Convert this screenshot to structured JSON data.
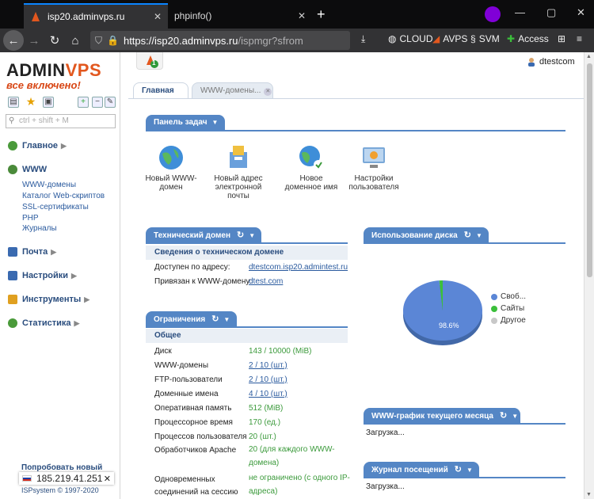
{
  "browser": {
    "tabs": [
      {
        "title": "isp20.adminvps.ru",
        "active": true
      },
      {
        "title": "phpinfo()",
        "active": false
      }
    ],
    "new_tab": "+",
    "url_host": "https://isp20.adminvps.ru",
    "url_rest": "/ispmgr?sfrom",
    "bookmarks": [
      "CLOUD",
      "AVPS",
      "SVM",
      "Access"
    ],
    "window_controls": [
      "—",
      "▢",
      "✕"
    ]
  },
  "logo": {
    "brand_a": "ADMIN",
    "brand_b": "VPS",
    "tagline": "все включено!"
  },
  "sidebar": {
    "search_placeholder": "ctrl + shift + M",
    "sections": [
      {
        "label": "Главное",
        "icon": "leaf-icon",
        "color": "#4a9a3a"
      },
      {
        "label": "WWW",
        "icon": "globe-icon",
        "color": "#4a8a3a"
      },
      {
        "label": "Почта",
        "icon": "mail-icon",
        "color": "#3a6ab0"
      },
      {
        "label": "Настройки",
        "icon": "settings-icon",
        "color": "#3a6ab0"
      },
      {
        "label": "Инструменты",
        "icon": "tools-icon",
        "color": "#e0a020"
      },
      {
        "label": "Статистика",
        "icon": "stats-icon",
        "color": "#4a9a3a"
      }
    ],
    "www_items": [
      "WWW-домены",
      "Каталог Web-скриптов",
      "SSL-сертификаты",
      "PHP",
      "Журналы"
    ],
    "try_new": "Попробовать новый",
    "copyright": "ISPsystem © 1997-2020"
  },
  "ip_tooltip": {
    "ip": "185.219.41.251",
    "close": "✕"
  },
  "header": {
    "user": "dtestcom",
    "badge": "1"
  },
  "tabs": [
    {
      "label": "Главная"
    },
    {
      "label": "WWW-домены..."
    }
  ],
  "tasks": {
    "title": "Панель задач",
    "items": [
      {
        "label1": "Новый WWW-",
        "label2": "домен",
        "label3": ""
      },
      {
        "label1": "Новый адрес",
        "label2": "электронной",
        "label3": "почты"
      },
      {
        "label1": "Новое",
        "label2": "доменное имя",
        "label3": ""
      },
      {
        "label1": "Настройки",
        "label2": "пользователя",
        "label3": ""
      }
    ]
  },
  "tech_domain": {
    "title": "Технический домен",
    "subheader": "Сведения о техническом домене",
    "rows": [
      {
        "key": "Доступен по адресу:",
        "value": "dtestcom.isp20.admintest.ru"
      },
      {
        "key": "Привязан к WWW-домену:",
        "value": "dtest.com"
      }
    ]
  },
  "limits": {
    "title": "Ограничения",
    "subheader": "Общее",
    "rows": [
      {
        "key": "Диск",
        "value": "143 / 10000 (MiB)",
        "link": false
      },
      {
        "key": "WWW-домены",
        "value": "2 / 10 (шт.)",
        "link": true
      },
      {
        "key": "FTP-пользователи",
        "value": "2 / 10 (шт.)",
        "link": true
      },
      {
        "key": "Доменные имена",
        "value": "4 / 10 (шт.)",
        "link": true
      },
      {
        "key": "Оперативная память",
        "value": "512 (MiB)",
        "link": false
      },
      {
        "key": "Процессорное время",
        "value": "170 (ед.)",
        "link": false
      },
      {
        "key": "Процессов пользователя",
        "value": "20 (шт.)",
        "link": false
      }
    ],
    "apache_key": "Обработчиков Apache",
    "apache_value1": "20 (для каждого WWW-",
    "apache_value2": "домена)",
    "conn_key1": "Одновременных",
    "conn_key2": "соединений на сессию",
    "conn_value1": "не ограничено (с одного IP-",
    "conn_value2": "адреса)"
  },
  "disk": {
    "title": "Использование диска",
    "slice_label": "98.6%",
    "legend": [
      {
        "label": "Своб...",
        "color": "#5b86d6"
      },
      {
        "label": "Сайты",
        "color": "#3bbf3b"
      },
      {
        "label": "Другое",
        "color": "#c8c8c8"
      }
    ]
  },
  "chart_data": {
    "type": "pie",
    "title": "Использование диска",
    "labels": [
      "Своб...",
      "Сайты",
      "Другое"
    ],
    "values": [
      98.6,
      1.4,
      0
    ],
    "colors": [
      "#5b86d6",
      "#3bbf3b",
      "#c8c8c8"
    ]
  },
  "www_graph": {
    "title": "WWW-график текущего месяца",
    "status": "Загрузка..."
  },
  "visits": {
    "title": "Журнал посещений",
    "status": "Загрузка..."
  }
}
